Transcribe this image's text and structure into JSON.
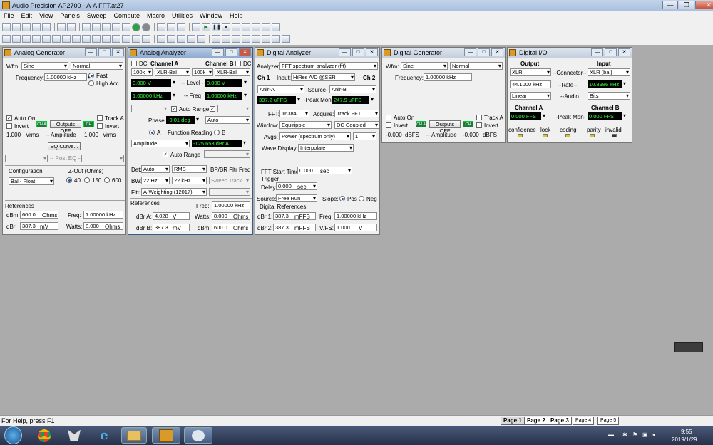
{
  "window": {
    "title": "Audio Precision AP2700 - A-A FFT.at27",
    "min": "—",
    "max": "❐",
    "close": "✕"
  },
  "menu": [
    "File",
    "Edit",
    "View",
    "Panels",
    "Sweep",
    "Compute",
    "Macro",
    "Utilities",
    "Window",
    "Help"
  ],
  "analog_generator": {
    "title": "Analog Generator",
    "wfm_label": "Wfm:",
    "wfm": "Sine",
    "wfm2": "Normal",
    "frequency_label": "Frequency:",
    "frequency": "1.00000 kHz",
    "fast": "Fast",
    "high_acc": "High Acc.",
    "auto_on": "Auto On",
    "track_a": "Track A",
    "invert": "Invert",
    "invert2": "Invert",
    "chA": "CH A",
    "chB": "CH B",
    "outputs": "Outputs OFF",
    "amp_a": "1.000",
    "amp_a_unit": "Vrms",
    "amplitude_label": "-- Amplitude",
    "amp_b": "1.000",
    "amp_b_unit": "Vrms",
    "eq_curve": "EQ Curve...",
    "post_eq": "-- Post EQ --",
    "configuration_label": "Configuration",
    "configuration": "Bal - Float",
    "zout_label": "Z-Out (Ohms)",
    "z40": "40",
    "z150": "150",
    "z600": "600",
    "references": "References",
    "dbm_label": "dBm:",
    "dbm": "600.0",
    "dbm_unit": "Ohms",
    "freq_label": "Freq:",
    "freq": "1.00000 kHz",
    "dbr_label": "dBr:",
    "dbr": "387.3",
    "dbr_unit": "mV",
    "watts_label": "Watts:",
    "watts": "8.000",
    "watts_unit": "Ohms"
  },
  "analog_analyzer": {
    "title": "Analog Analyzer",
    "dc": "DC",
    "channel_a": "Channel A",
    "channel_b": "Channel B",
    "dc2": "DC",
    "range_a": "100k",
    "src_a": "XLR-Bal",
    "range_b": "100k",
    "src_b": "XLR-Bal",
    "level_a": "0.000  V",
    "level_label": "-- Level --",
    "level_b": "0.000  V",
    "freq_a": "1.00000 kHz",
    "freq_label": "-- Freq",
    "freq_b": "1.00000 kHz",
    "auto_range": "Auto Range",
    "phase_label": "Phase:",
    "phase": "-0.01  deg",
    "phase_mode": "Auto",
    "a_label": "A",
    "function_reading": "Function Reading",
    "b_label": "B",
    "function": "Amplitude",
    "function_value": "-125.653 dBr A",
    "auto_range2": "Auto Range",
    "det_label": "Det:",
    "det": "Auto",
    "rms": "RMS",
    "bp_label": "BP/BR Fltr Freq",
    "bw_label": "BW:",
    "bw_lo": "22 Hz",
    "bw_hi": "22 kHz",
    "sweep_track": "Sweep Track",
    "fltr_label": "Fltr:",
    "fltr": "A-Weighting  (12017)",
    "references": "References",
    "ref_freq_label": "Freq:",
    "ref_freq": "1.00000 kHz",
    "dbra_label": "dBr A:",
    "dbra": "4.028",
    "dbra_unit": "V",
    "watts_label": "Watts:",
    "watts": "8.000",
    "watts_unit": "Ohms",
    "dbrb_label": "dBr B:",
    "dbrb": "387.3",
    "dbrb_unit": "mV",
    "dbm_label": "dBm:",
    "dbm": "600.0",
    "dbm_unit": "Ohms"
  },
  "digital_analyzer": {
    "title": "Digital Analyzer",
    "analyzer_label": "Analyzer:",
    "analyzer": "FFT spectrum analyzer (fft)",
    "ch1": "Ch 1",
    "input_label": "Input:",
    "input": "HiRes A/D @SSR",
    "ch2": "Ch 2",
    "src1": "Anlr-A",
    "source_label": "-Source-",
    "src2": "Anlr-B",
    "peak1": "307.2  uFFS",
    "peak_label": "-Peak Mon-",
    "peak2": "247.9  uFFS",
    "fft_label": "FFT:",
    "fft": "16384",
    "acquire_label": "Acquire:",
    "acquire": "Track FFT",
    "window_label": "Window:",
    "window": "Equiripple",
    "coupling": "DC Coupled",
    "avgs_label": "Avgs:",
    "avgs": "Power (spectrum only)",
    "avgs_n": "1",
    "wave_display_label": "Wave Display:",
    "wave_display": "Interpolate",
    "fft_start_label": "FFT Start Time:",
    "fft_start": "0.000",
    "fft_start_unit": "sec",
    "trigger_label": "Trigger",
    "delay_label": "Delay:",
    "delay": "0.000",
    "delay_unit": "sec",
    "source2_label": "Source:",
    "source2": "Free Run",
    "slope_label": "Slope:",
    "pos": "Pos",
    "neg": "Neg",
    "digital_references": "Digital References",
    "dbr1_label": "dBr 1:",
    "dbr1": "387.3",
    "dbr1_unit": "mFFS",
    "freq_label": "Freq:",
    "freq": "1.00000 kHz",
    "dbr2_label": "dBr 2:",
    "dbr2": "387.3",
    "dbr2_unit": "mFFS",
    "vfs_label": "V/FS:",
    "vfs": "1.000",
    "vfs_unit": "V"
  },
  "digital_generator": {
    "title": "Digital Generator",
    "wfm_label": "Wfm:",
    "wfm": "Sine",
    "wfm2": "Normal",
    "frequency_label": "Frequency:",
    "frequency": "1.00000 kHz",
    "auto_on": "Auto On",
    "track_a": "Track A",
    "invert": "Invert",
    "invert2": "Invert",
    "chA": "CH A",
    "chB": "CH B",
    "outputs": "Outputs OFF",
    "amp_a": "-0.000",
    "amp_a_unit": "dBFS",
    "amplitude_label": "-- Amplitude",
    "amp_b": "-0.000",
    "amp_b_unit": "dBFS"
  },
  "digital_io": {
    "title": "Digital I/O",
    "output_label": "Output",
    "input_label": "Input",
    "out_conn": "XLR",
    "connector_label": "--Connector--",
    "in_conn": "XLR (bal)",
    "out_rate": "44.1000 kHz",
    "rate_label": "--Rate--",
    "in_rate": "10.8986 kHz",
    "out_audio": "Linear",
    "audio_label": "--Audio",
    "in_audio": "Bits",
    "channel_a": "Channel A",
    "channel_b": "Channel B",
    "peak_a": "0.000  FFS",
    "peak_label": "-Peak Mon-",
    "peak_b": "0.000  FFS",
    "confidence": "confidence",
    "lock": "lock",
    "coding": "coding",
    "parity": "parity",
    "invalid": "invalid"
  },
  "status": {
    "help": "For Help, press F1",
    "pages": [
      "Page 1",
      "Page 2",
      "Page 3",
      "Page 4",
      "Page 5"
    ]
  },
  "clock": {
    "time": "9:55",
    "date": "2019/1/29"
  }
}
